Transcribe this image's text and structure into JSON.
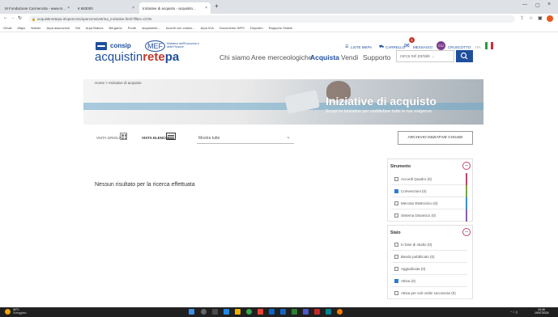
{
  "browser": {
    "tabs": [
      {
        "label": "M Fondazione Carmencita - www.m..."
      },
      {
        "label": "€ 683000"
      },
      {
        "label": "Iniziative di acquisto - acquistin..."
      }
    ],
    "new_tab": "+",
    "url": "acquistinretepa.it/opencms/opencms/vetrina_iniziative.html?filter=CON",
    "bookmarks": [
      "Gmail",
      "Maps",
      "Notizie",
      "Arpa assunzioni",
      "Sdi",
      "Arpa Bianca",
      "Bergamo",
      "Ponte",
      "acquistinre...",
      "Accedi con codice...",
      "Arpa IGA",
      "Documento INPS",
      "Deposito",
      "Rapporto Sintesi"
    ]
  },
  "site": {
    "brand": {
      "consip": "consip",
      "mef": "MEF",
      "mef_sub": "Ministero dell'Economia e delle Finanze"
    },
    "logo": {
      "part1": "acquistin",
      "part2": "rete",
      "part3": "pa"
    },
    "topbar": {
      "liste": "LISTE MEPA",
      "carrello": "CARRELLO",
      "messaggi": "MESSAGGI",
      "messaggi_count": "1",
      "cruscotto": "CRUSCOTTO",
      "avatar": "CU",
      "lang": "ITA"
    },
    "nav": {
      "chi_siamo": "Chi siamo",
      "aree": "Aree merceologiche",
      "acquista": "Acquista",
      "vendi": "Vendi",
      "supporto": "Supporto"
    },
    "search": {
      "placeholder": "cerca nel portale ..."
    },
    "breadcrumb": {
      "home": "Home",
      "sep": ">",
      "current": "Iniziative di acquisto"
    },
    "hero": {
      "title": "Iniziative di acquisto",
      "subtitle": "Scopri le iniziative per soddisfare tutte le tue esigenze"
    },
    "toolbar": {
      "vista_griglia": "VISTA GRIGLIA",
      "vista_elenco": "VISTA ELENCO",
      "select_value": "Mostra tutte",
      "archive_button": "ARCHIVIO INIZIATIVE CHIUSE"
    },
    "empty": "Nessun risultato per la ricerca effettuata",
    "filters": {
      "strumento": {
        "title": "Strumento",
        "items": [
          {
            "label": "Accordi Quadro (0)",
            "checked": false,
            "color": "#c1466b"
          },
          {
            "label": "Convenzioni (0)",
            "checked": true,
            "color": "#7ba23f"
          },
          {
            "label": "Mercato Elettronico (0)",
            "checked": false,
            "color": "#3a8fc9"
          },
          {
            "label": "Sistema Dinamico (0)",
            "checked": false,
            "color": "#8e5aa8"
          }
        ]
      },
      "stato": {
        "title": "Stato",
        "items": [
          {
            "label": "In fase di studio (0)",
            "checked": false
          },
          {
            "label": "Bando pubblicato (0)",
            "checked": false
          },
          {
            "label": "Aggiudicata (0)",
            "checked": false
          },
          {
            "label": "Attiva (0)",
            "checked": true
          },
          {
            "label": "Attiva per soli ordini successivi (0)",
            "checked": false
          }
        ]
      }
    }
  },
  "taskbar": {
    "weather": "30°C",
    "weather_sub": "Soleggiato",
    "clock": "10:49",
    "date": "19/07/2024"
  }
}
